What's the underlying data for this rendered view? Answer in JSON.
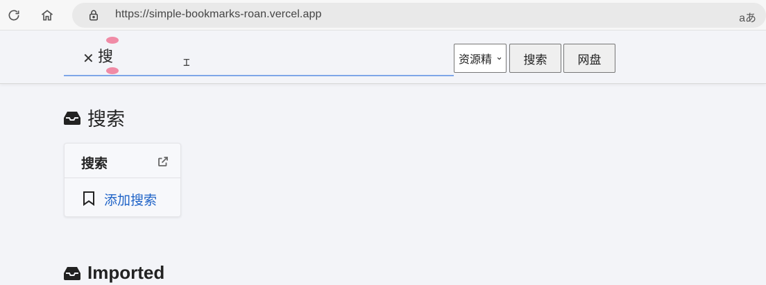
{
  "browser": {
    "url": "https://simple-bookmarks-roan.vercel.app",
    "read_aloud": "aあ"
  },
  "search": {
    "value": "搜",
    "engine_selected": "资源精",
    "search_button": "搜索",
    "disk_button": "网盘"
  },
  "sections": {
    "search_title": "搜索",
    "imported_title": "Imported"
  },
  "card": {
    "title": "搜索",
    "add_link": "添加搜索"
  },
  "colors": {
    "accent_link": "#1f63c7",
    "input_underline": "#7ea6e8",
    "background": "#f3f4f8"
  },
  "icons": [
    "refresh-icon",
    "home-icon",
    "lock-icon",
    "clear-icon",
    "inbox-icon",
    "external-link-icon",
    "bookmark-icon"
  ]
}
